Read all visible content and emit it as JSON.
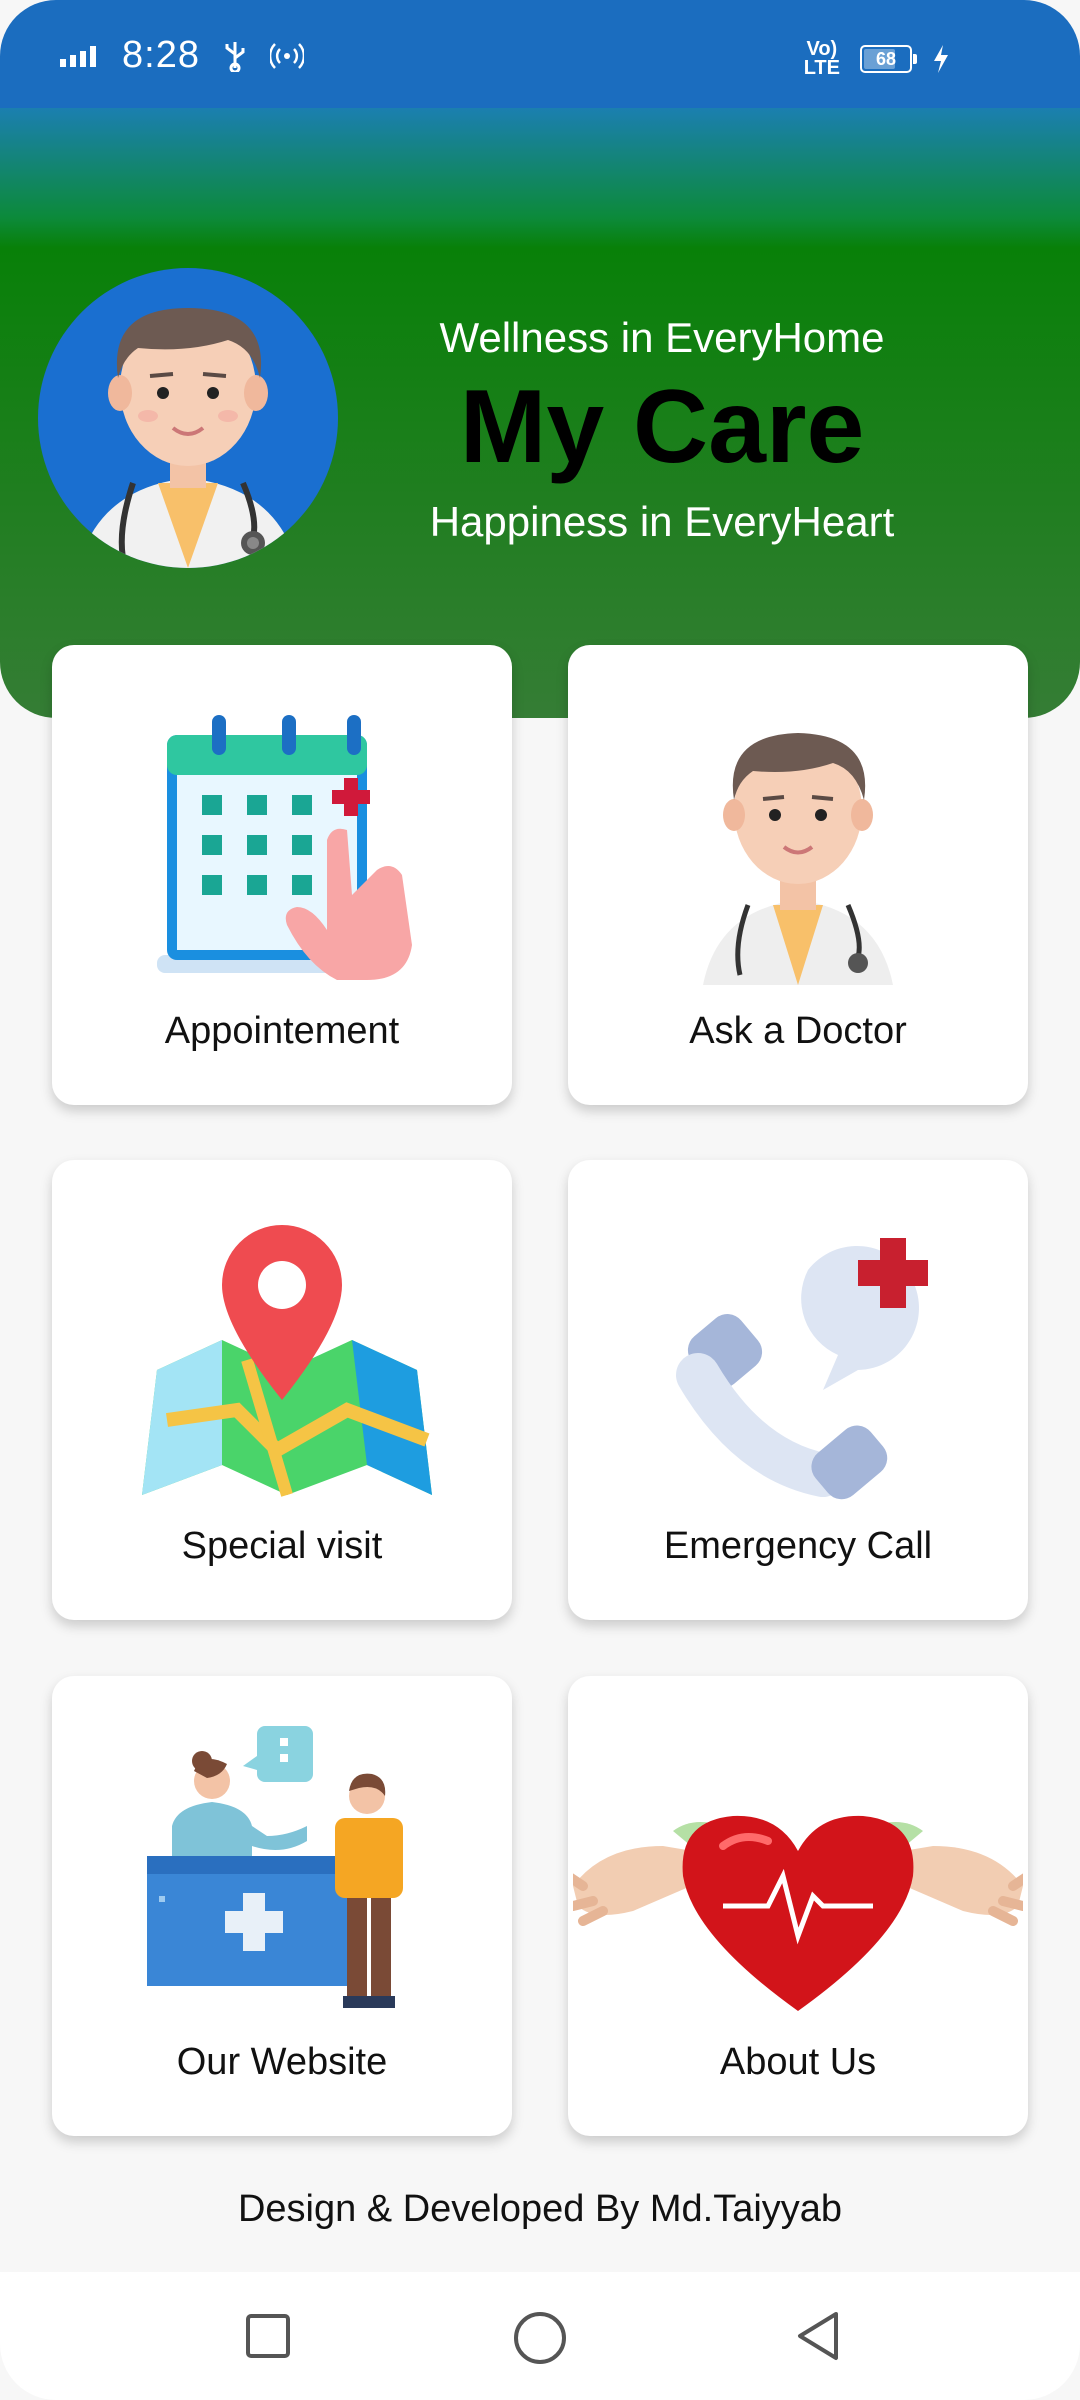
{
  "status_bar": {
    "time": "8:28",
    "battery": "68",
    "network": "VoLTE",
    "icons": [
      "signal-icon",
      "usb-icon",
      "hotspot-icon",
      "volte-icon",
      "battery-icon",
      "charging-icon"
    ]
  },
  "header": {
    "tagline_top": "Wellness in EveryHome",
    "title": "My Care",
    "tagline_bottom": "Happiness in EveryHeart"
  },
  "cards": [
    {
      "label": "Appointement",
      "icon": "calendar-appointment-icon"
    },
    {
      "label": "Ask a Doctor",
      "icon": "doctor-icon"
    },
    {
      "label": "Special visit",
      "icon": "map-pin-icon"
    },
    {
      "label": "Emergency Call",
      "icon": "emergency-phone-icon"
    },
    {
      "label": "Our Website",
      "icon": "reception-icon"
    },
    {
      "label": "About Us",
      "icon": "heart-hands-icon"
    }
  ],
  "footer": {
    "credit": "Design & Developed By Md.Taiyyab"
  },
  "nav_bar": {
    "buttons": [
      "recents-button",
      "home-button",
      "back-button"
    ]
  },
  "colors": {
    "status_bar": "#1b6dbf",
    "header_green": "#357d35",
    "avatar_bg": "#1a6fd0",
    "accent_red": "#c8202f"
  }
}
